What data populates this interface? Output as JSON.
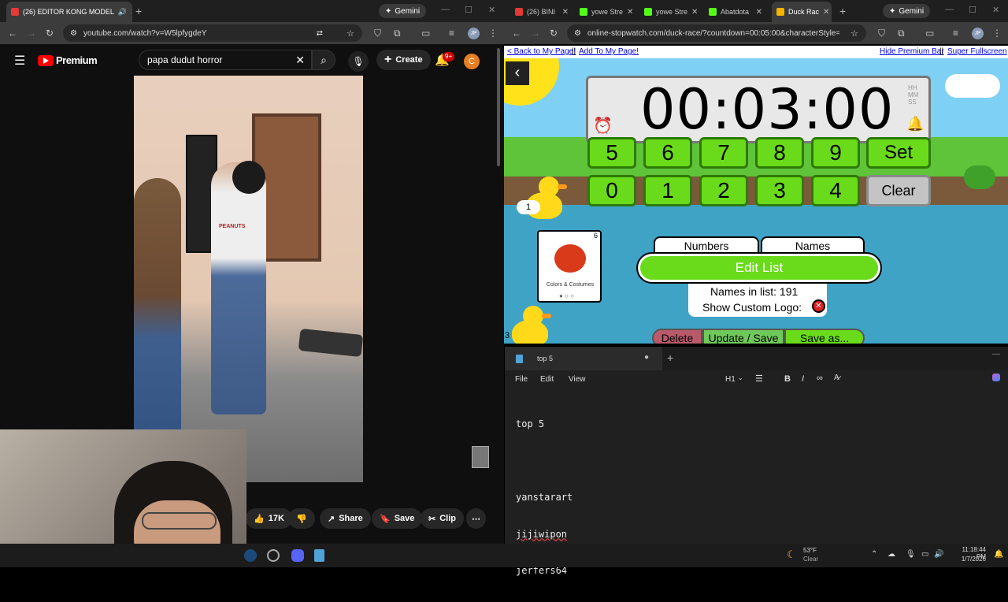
{
  "left_browser": {
    "tabs": [
      {
        "title": "(26) EDITOR KONG MODEL",
        "active": true,
        "favicon_color": "#e53935"
      }
    ],
    "gemini_label": "Gemini",
    "url": "youtube.com/watch?v=W5lpfygdeY",
    "profile": "JP"
  },
  "youtube": {
    "logo_text": "Premium",
    "search_value": "papa dudut horror",
    "create_label": "Create",
    "notif_count": "9+",
    "avatar_letter": "C",
    "likes": "17K",
    "share_label": "Share",
    "save_label": "Save",
    "clip_label": "Clip",
    "overlay_text_on_shirt": "PEANUTS"
  },
  "right_browser": {
    "tabs": [
      {
        "title": "(26) BINI",
        "favicon_color": "#e53935"
      },
      {
        "title": "yowe Stre",
        "favicon_color": "#53fc18"
      },
      {
        "title": "yowe Stre",
        "favicon_color": "#53fc18"
      },
      {
        "title": "Abatdota",
        "favicon_color": "#53fc18"
      },
      {
        "title": "Duck Rac",
        "favicon_color": "#f4b400",
        "active": true
      }
    ],
    "gemini_label": "Gemini",
    "url": "online-stopwatch.com/duck-race/?countdown=00:05:00&characterStyle=0&...",
    "profile": "JP"
  },
  "stopwatch": {
    "back_link": "< Back to My Page!",
    "add_link": "Add To My Page!",
    "hide_link": "Hide Premium Bar",
    "fullscreen_link": "Super Fullscreen",
    "time": "00:03:00",
    "units": [
      "HH",
      "MM",
      "SS"
    ],
    "row1": [
      "5",
      "6",
      "7",
      "8",
      "9"
    ],
    "row2": [
      "0",
      "1",
      "2",
      "3",
      "4"
    ],
    "set_label": "Set",
    "clear_label": "Clear",
    "tab_numbers": "Numbers",
    "tab_names": "Names",
    "edit_list_label": "Edit List",
    "names_count": "Names in list: 191",
    "custom_logo_label": "Show Custom Logo:",
    "delete_label": "Delete",
    "update_label": "Update / Save",
    "save_as_label": "Save as...",
    "card_caption": "Colors & Costumes",
    "card_number": "6",
    "duck1_number": "1",
    "duck2_number": "3"
  },
  "notepad": {
    "tab_title": "top 5",
    "menu": [
      "File",
      "Edit",
      "View"
    ],
    "heading_label": "H1",
    "lines": [
      "top 5",
      "",
      "yanstarart",
      "jijiwipon",
      "jerfers64"
    ]
  },
  "taskbar": {
    "temp": "53°F",
    "weather": "Clear",
    "time": "11:18:44 PM",
    "date": "1/7/2026"
  }
}
